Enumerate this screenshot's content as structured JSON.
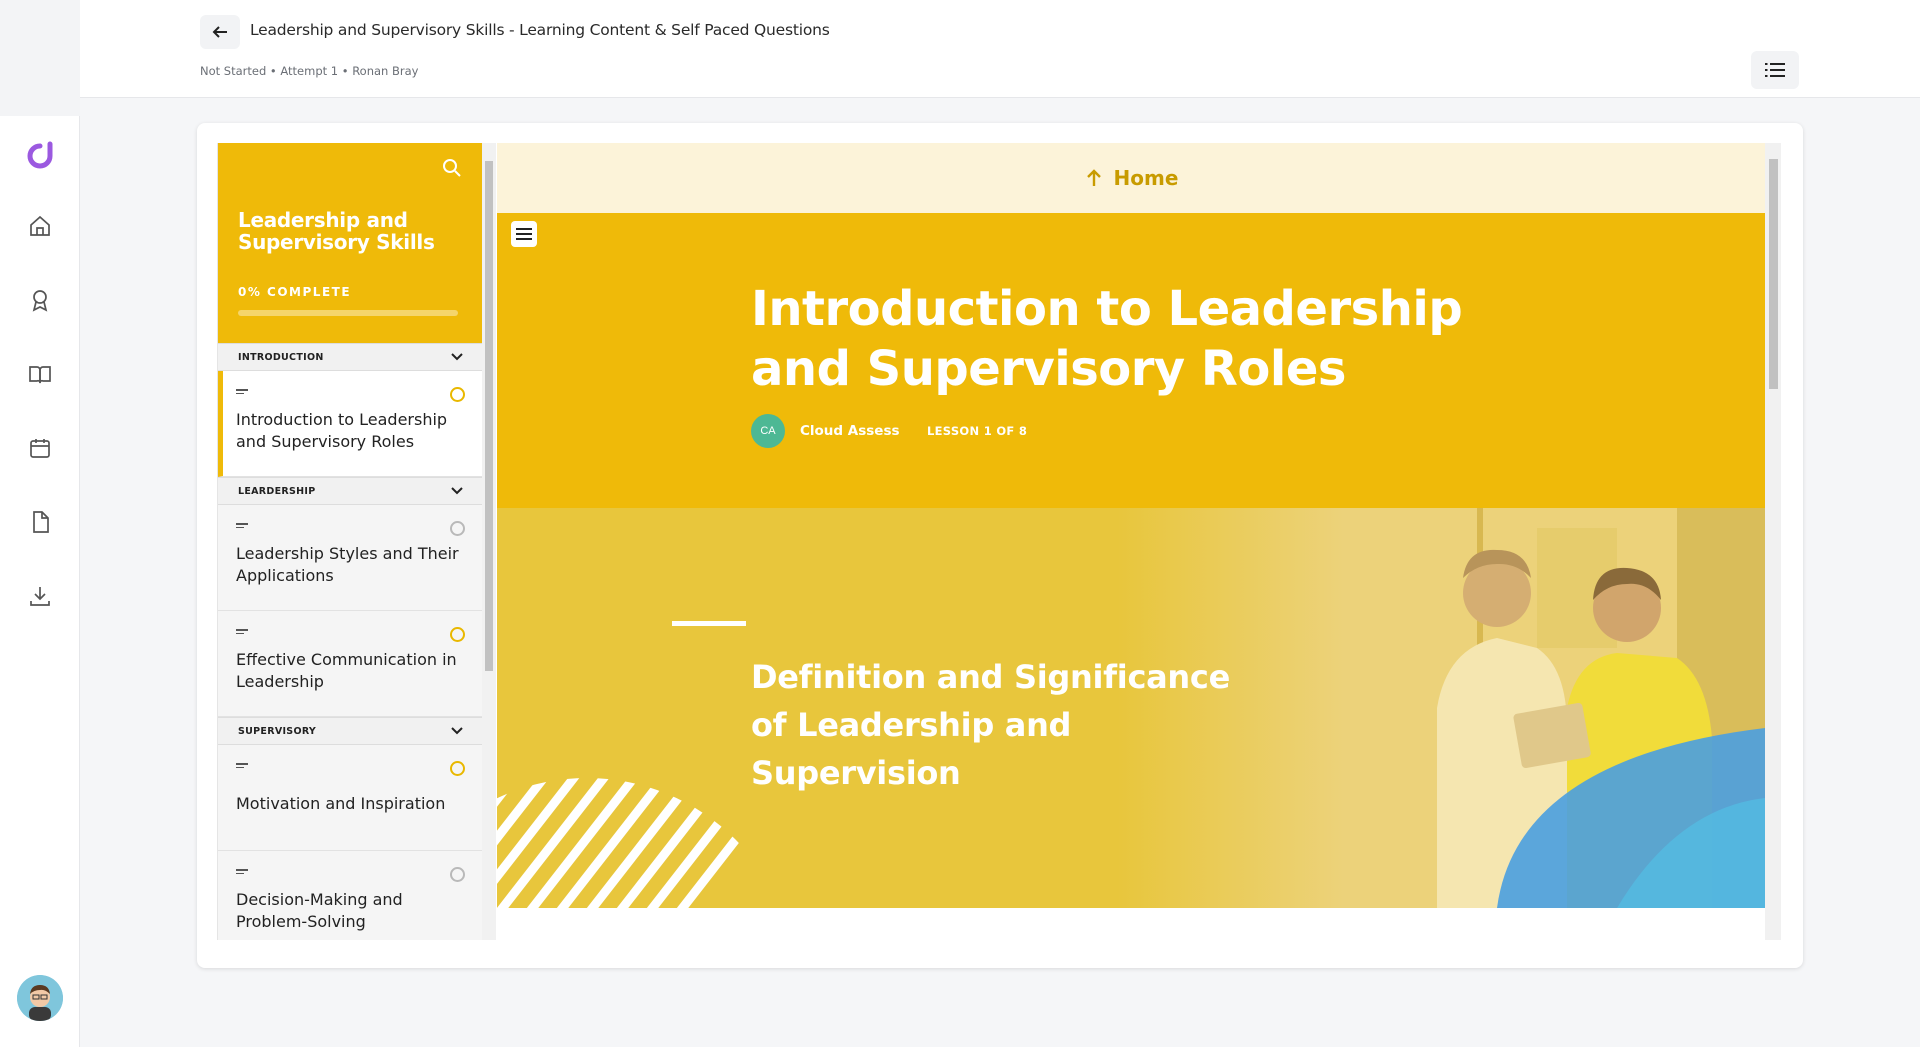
{
  "header": {
    "title": "Leadership and Supervisory Skills - Learning Content & Self Paced Questions",
    "meta": "Not Started • Attempt 1 • Ronan Bray",
    "back_icon": "arrow-left-icon",
    "outline_icon": "list-icon"
  },
  "rail": {
    "items": [
      "home-icon",
      "award-icon",
      "book-icon",
      "calendar-icon",
      "file-icon",
      "download-icon"
    ]
  },
  "course": {
    "title": "Leadership and Supervisory Skills",
    "progress_label": "0% COMPLETE",
    "progress": 0
  },
  "sections": [
    {
      "label": "INTRODUCTION",
      "lessons": [
        {
          "title": "Introduction to Leadership and Supervisory Roles",
          "active": true
        }
      ]
    },
    {
      "label": "LEARDERSHIP",
      "lessons": [
        {
          "title": "Leadership Styles and Their Applications"
        },
        {
          "title": "Effective Communication in Leadership"
        }
      ]
    },
    {
      "label": "SUPERVISORY",
      "lessons": [
        {
          "title": "Motivation and Inspiration"
        },
        {
          "title": "Decision-Making and Problem-Solving"
        }
      ]
    }
  ],
  "content": {
    "home_label": "Home",
    "lesson_title": "Introduction to Leadership and Supervisory Roles",
    "author_initials": "CA",
    "author_name": "Cloud Assess",
    "lesson_count": "LESSON 1 OF 8",
    "banner_title": "Definition and Significance of Leadership and Supervision"
  },
  "colors": {
    "brand_yellow": "#efba09",
    "home_text": "#c89b00",
    "author_avatar": "#4db894",
    "accent_blue": "#4a9fe0"
  }
}
